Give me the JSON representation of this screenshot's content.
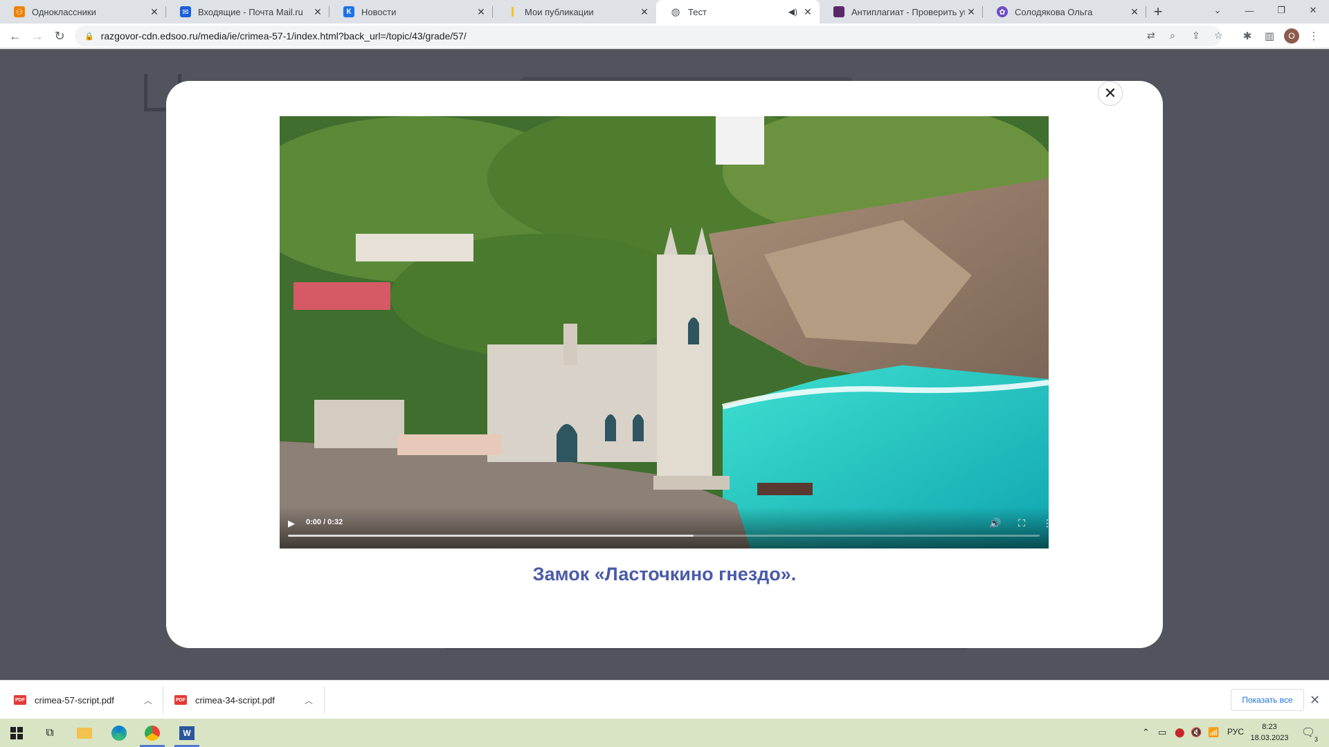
{
  "browser": {
    "tabs": [
      {
        "title": "Одноклассники",
        "favicon": "ok-icon",
        "color": "#ee8208",
        "glyph": "ok"
      },
      {
        "title": "Входящие - Почта Mail.ru",
        "favicon": "mail-icon",
        "color": "#1a5fdc",
        "glyph": "@"
      },
      {
        "title": "Новости",
        "favicon": "vk-icon",
        "color": "#1b73e8",
        "glyph": "vk"
      },
      {
        "title": "Мои публикации",
        "favicon": "dzen-icon",
        "color": "#f5c518",
        "glyph": ""
      },
      {
        "title": "Тест",
        "favicon": "globe-icon",
        "color": "#5f6368",
        "glyph": "",
        "active": true,
        "audio": true
      },
      {
        "title": "Антиплагиат - Проверить уник",
        "favicon": "antiplagiat-icon",
        "color": "#5a2a68",
        "glyph": ""
      },
      {
        "title": "Солодякова Ольга",
        "favicon": "community-icon",
        "color": "#6f4bc7",
        "glyph": "✿"
      }
    ],
    "url": "razgovor-cdn.edsoo.ru/media/ie/crimea-57-1/index.html?back_url=/topic/43/grade/57/",
    "profile_initial": "O"
  },
  "modal": {
    "close_label": "✕",
    "video": {
      "time": "0:00 / 0:32",
      "progress_buffered": 0.54
    },
    "caption": "Замок «Ласточкино гнездо»."
  },
  "downloads": {
    "items": [
      {
        "name": "crimea-57-script.pdf"
      },
      {
        "name": "crimea-34-script.pdf"
      }
    ],
    "show_all": "Показать все"
  },
  "taskbar": {
    "lang": "РУС",
    "time": "8:23",
    "date": "18.03.2023",
    "notifications": "3"
  }
}
